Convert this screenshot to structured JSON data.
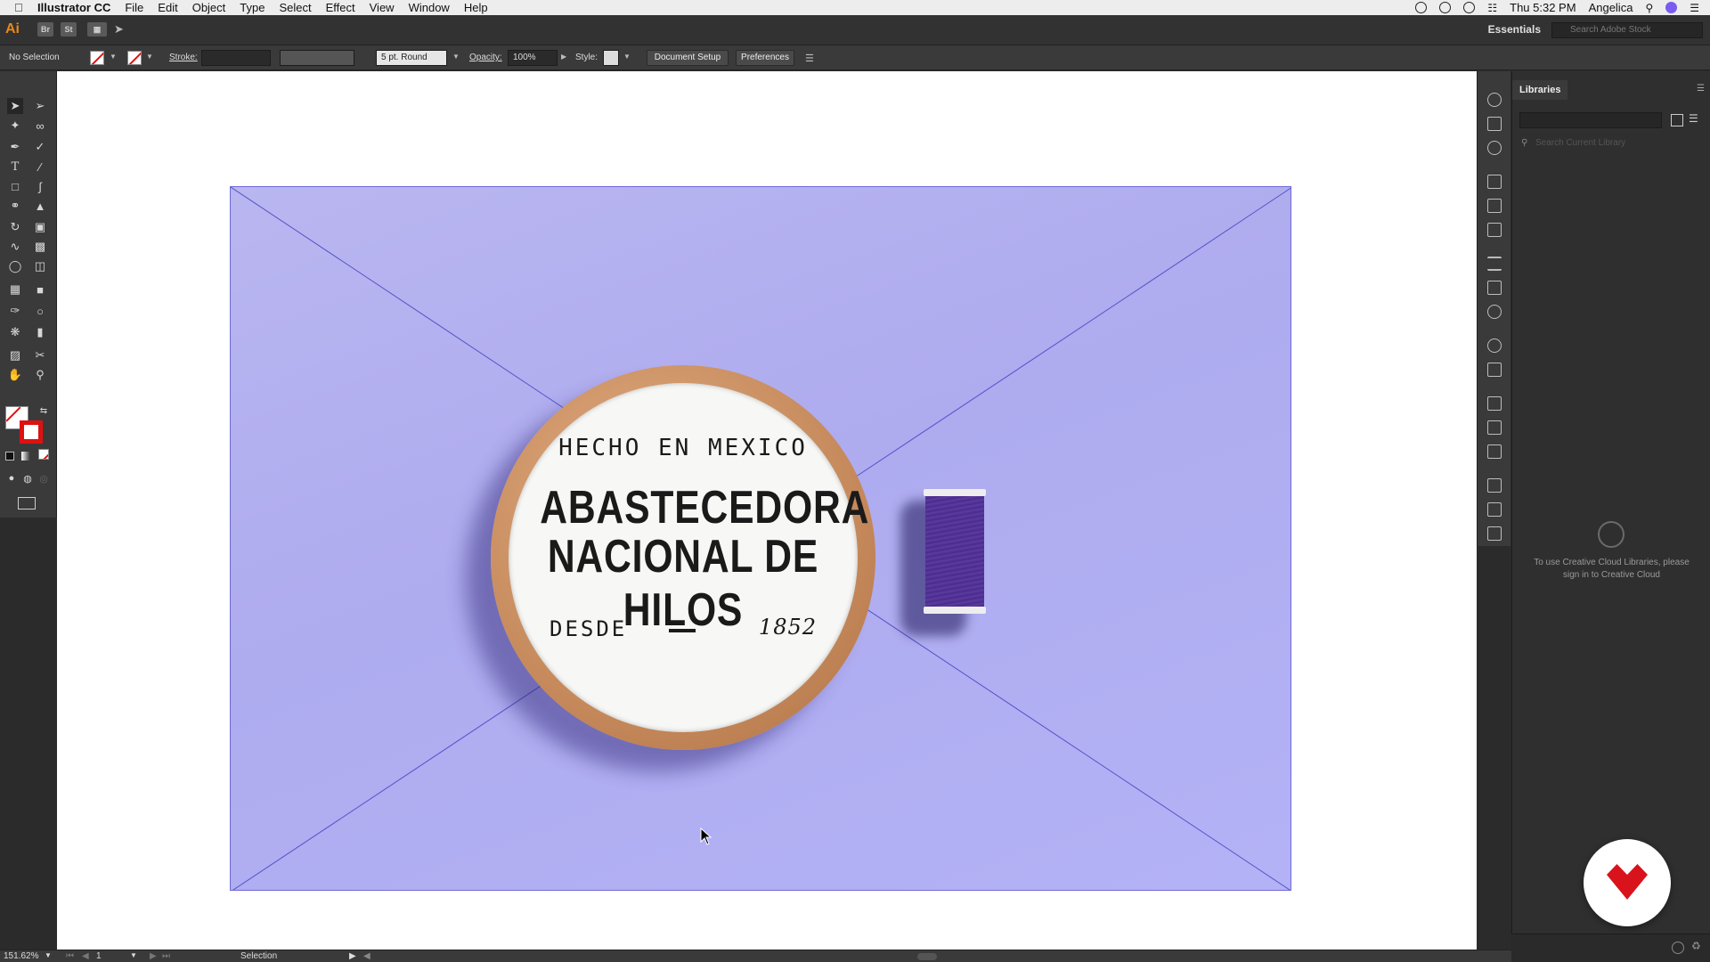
{
  "menubar": {
    "app_name": "Illustrator CC",
    "menus": [
      "File",
      "Edit",
      "Object",
      "Type",
      "Select",
      "Effect",
      "View",
      "Window",
      "Help"
    ],
    "clock": "Thu 5:32 PM",
    "user": "Angelica"
  },
  "appbar": {
    "logo": "Ai",
    "bridge": "Br",
    "stock": "St",
    "workspace": "Essentials",
    "stock_search_placeholder": "Search Adobe Stock"
  },
  "controlbar": {
    "selection": "No Selection",
    "stroke_label": "Stroke:",
    "brush": "5 pt. Round",
    "opacity_label": "Opacity:",
    "opacity_value": "100%",
    "style_label": "Style:",
    "document_setup": "Document Setup",
    "preferences": "Preferences"
  },
  "artwork": {
    "embroidery_top": "HECHO EN MEXICO",
    "embroidery_line1": "ABASTECEDORA",
    "embroidery_line2": "NACIONAL DE HILOS",
    "embroidery_left": "DESDE",
    "embroidery_year": "1852"
  },
  "libraries": {
    "tab": "Libraries",
    "search_placeholder": "Search Current Library",
    "signin_message": "To use Creative Cloud Libraries, please sign in to Creative Cloud"
  },
  "statusbar": {
    "zoom": "151.62%",
    "artboard": "1",
    "tool": "Selection"
  },
  "colors": {
    "accent_ai": "#e8881c",
    "artboard_bg": "#b4b1f2",
    "badge_red": "#d9131b"
  }
}
